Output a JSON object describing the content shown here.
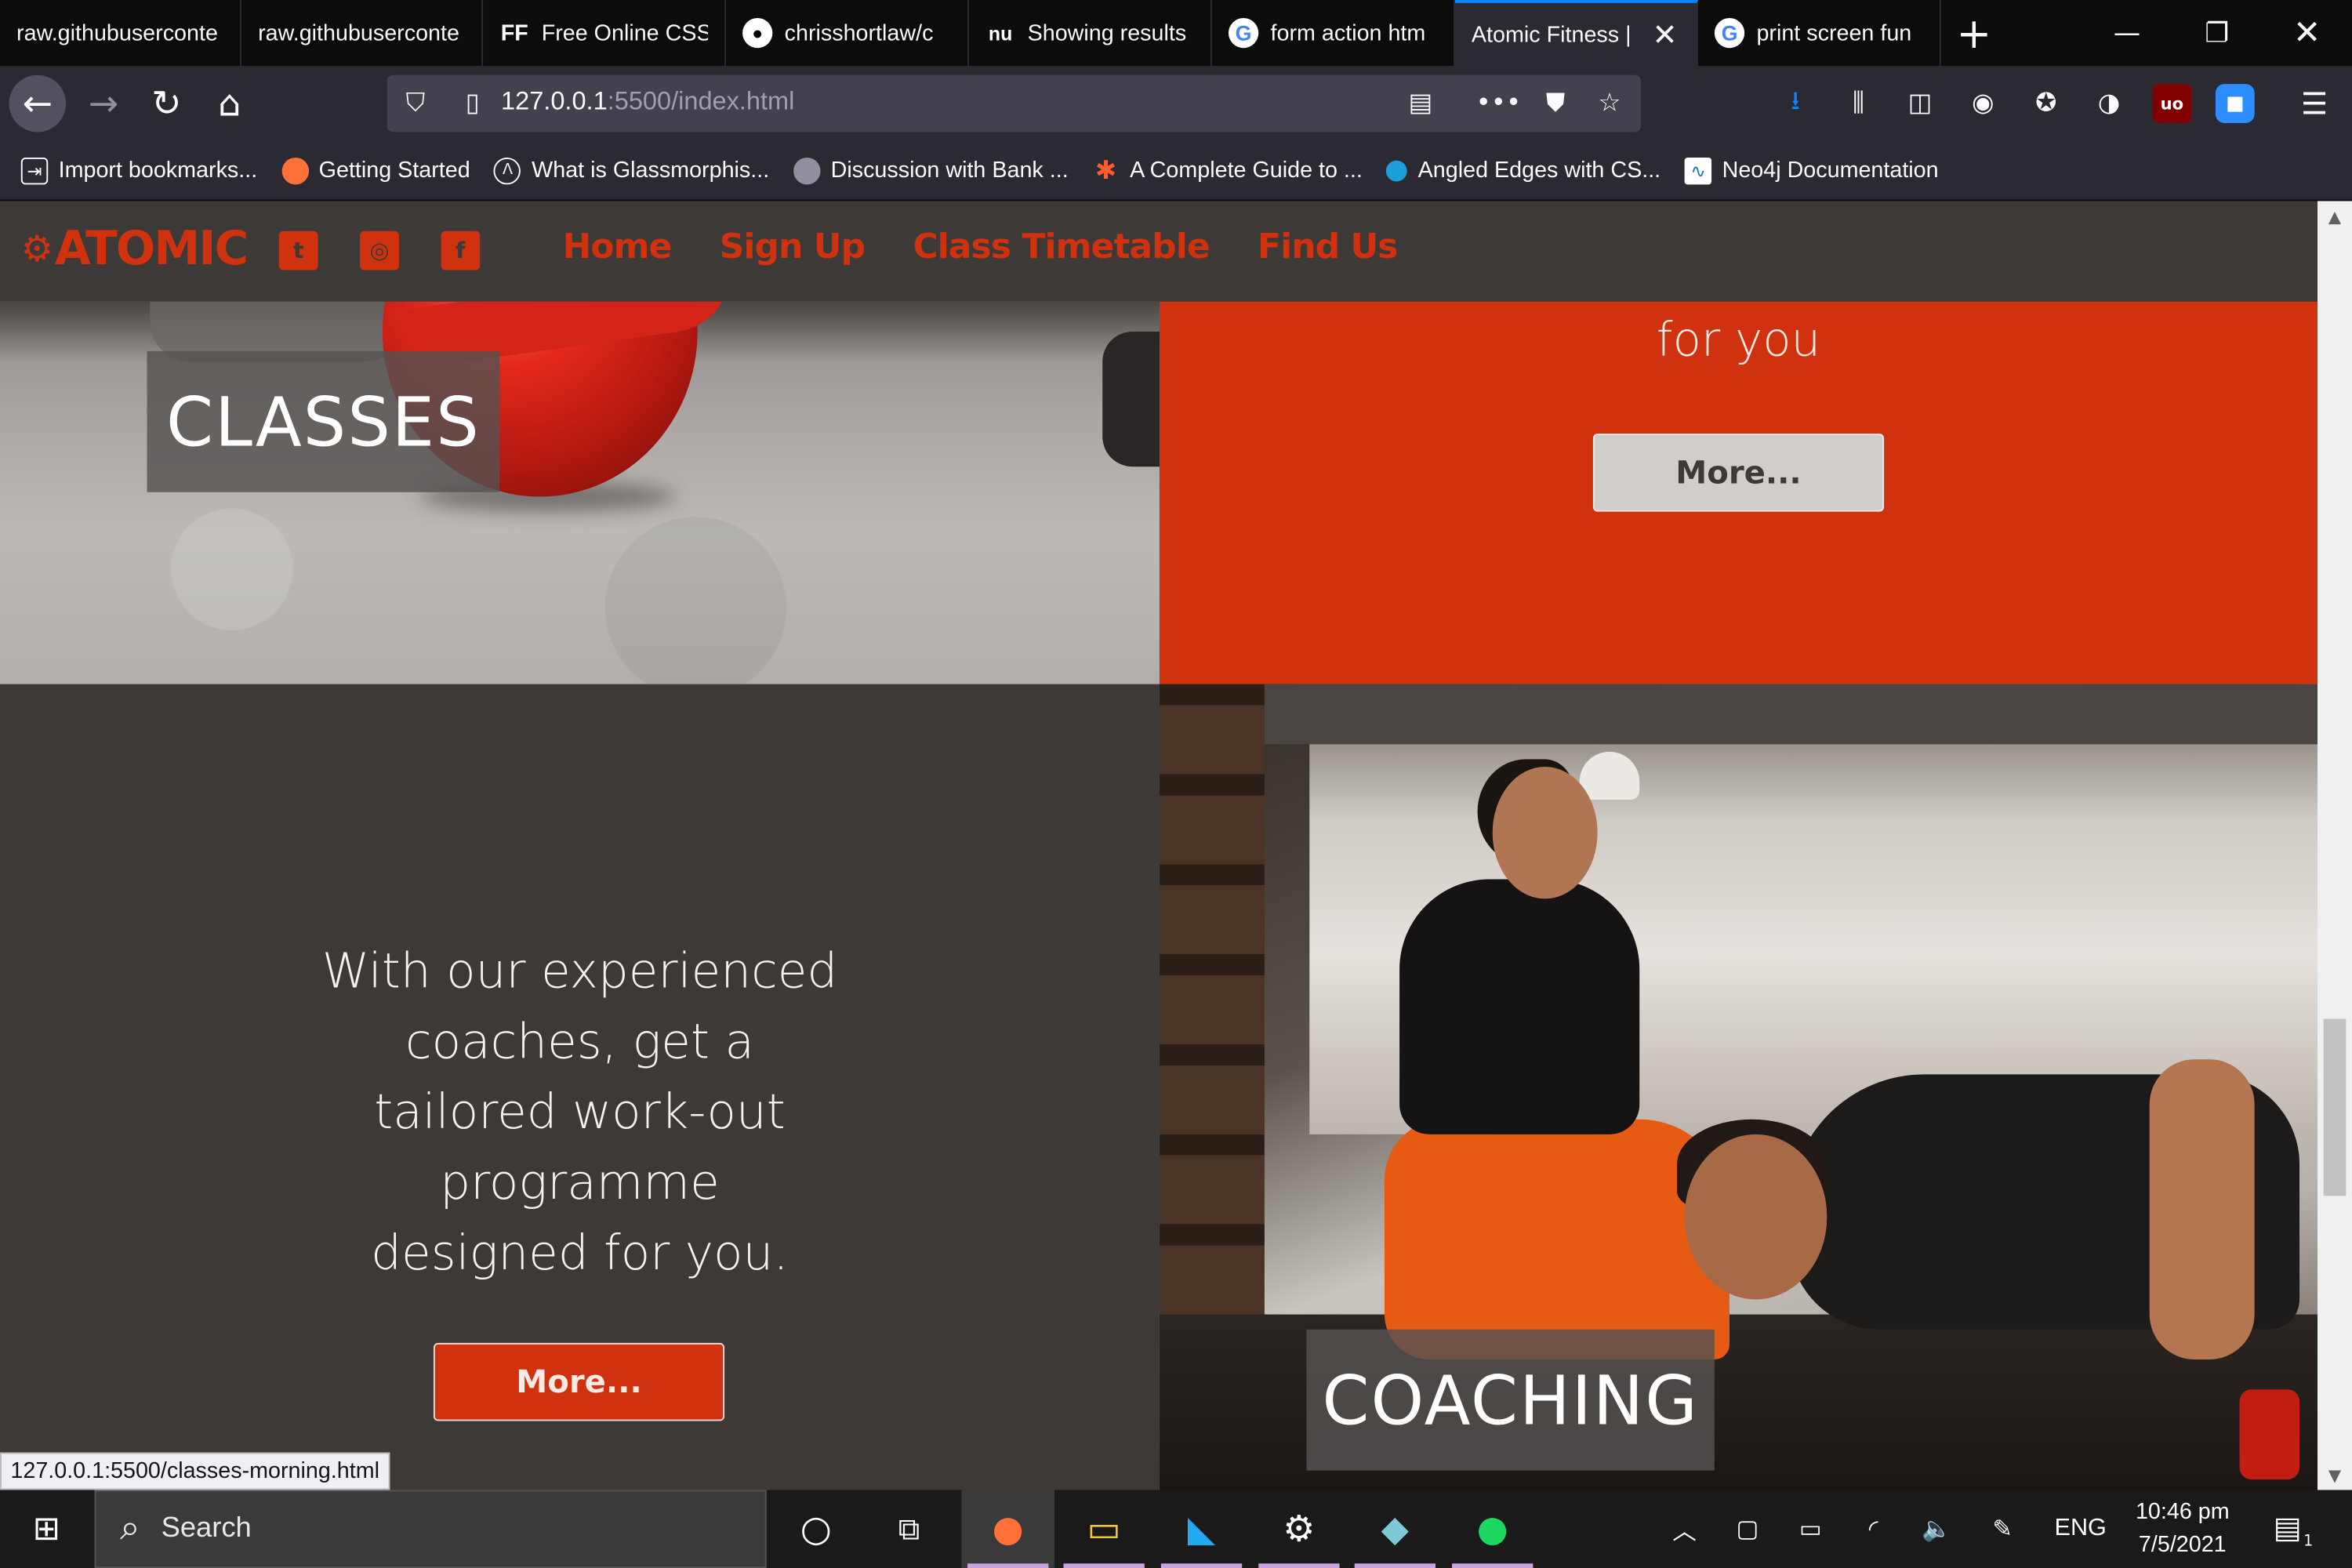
{
  "browser": {
    "tabs": [
      {
        "title": "raw.githubuserconte",
        "icon": "none"
      },
      {
        "title": "raw.githubuserconte",
        "icon": "none"
      },
      {
        "title": "Free Online CSS",
        "icon": "ff-icon",
        "favicon_text": "FF"
      },
      {
        "title": "chrisshortlaw/c",
        "icon": "github-icon"
      },
      {
        "title": "Showing results",
        "icon": "nu-icon",
        "favicon_text": "nu"
      },
      {
        "title": "form action htm",
        "icon": "google-icon",
        "favicon_text": "G"
      },
      {
        "title": "Atomic Fitness |",
        "icon": "none",
        "active": true
      },
      {
        "title": "print screen fun",
        "icon": "google-icon",
        "favicon_text": "G"
      }
    ],
    "url": {
      "host": "127.0.0.1",
      "rest": ":5500/index.html"
    },
    "bookmarks": [
      {
        "label": "Import bookmarks...",
        "icon": "import-icon"
      },
      {
        "label": "Getting Started",
        "icon": "firefox-icon"
      },
      {
        "label": "What is Glassmorphis...",
        "icon": "code-icon"
      },
      {
        "label": "Discussion with Bank ...",
        "icon": "chat-icon"
      },
      {
        "label": "A Complete Guide to ...",
        "icon": "star-burst-icon"
      },
      {
        "label": "Angled Edges with CS...",
        "icon": "dot-icon"
      },
      {
        "label": "Neo4j Documentation",
        "icon": "neo4j-icon"
      }
    ]
  },
  "site": {
    "logo": "ATOMIC",
    "nav": [
      "Home",
      "Sign Up",
      "Class Timetable",
      "Find Us"
    ],
    "classes_label": "CLASSES",
    "orange_text": "for you",
    "more_grey": "More...",
    "coach_lines": [
      "With our experienced",
      "coaches, get a",
      "tailored work-out",
      "programme",
      "designed for you."
    ],
    "more_orange": "More...",
    "coaching_label": "COACHING",
    "colors": {
      "brand": "#d0310f",
      "dark": "#3d3937"
    }
  },
  "status_url": "127.0.0.1:5500/classes-morning.html",
  "taskbar": {
    "search_placeholder": "Search",
    "language": "ENG",
    "time": "10:46 pm",
    "date": "7/5/2021",
    "notification_count": "1"
  }
}
